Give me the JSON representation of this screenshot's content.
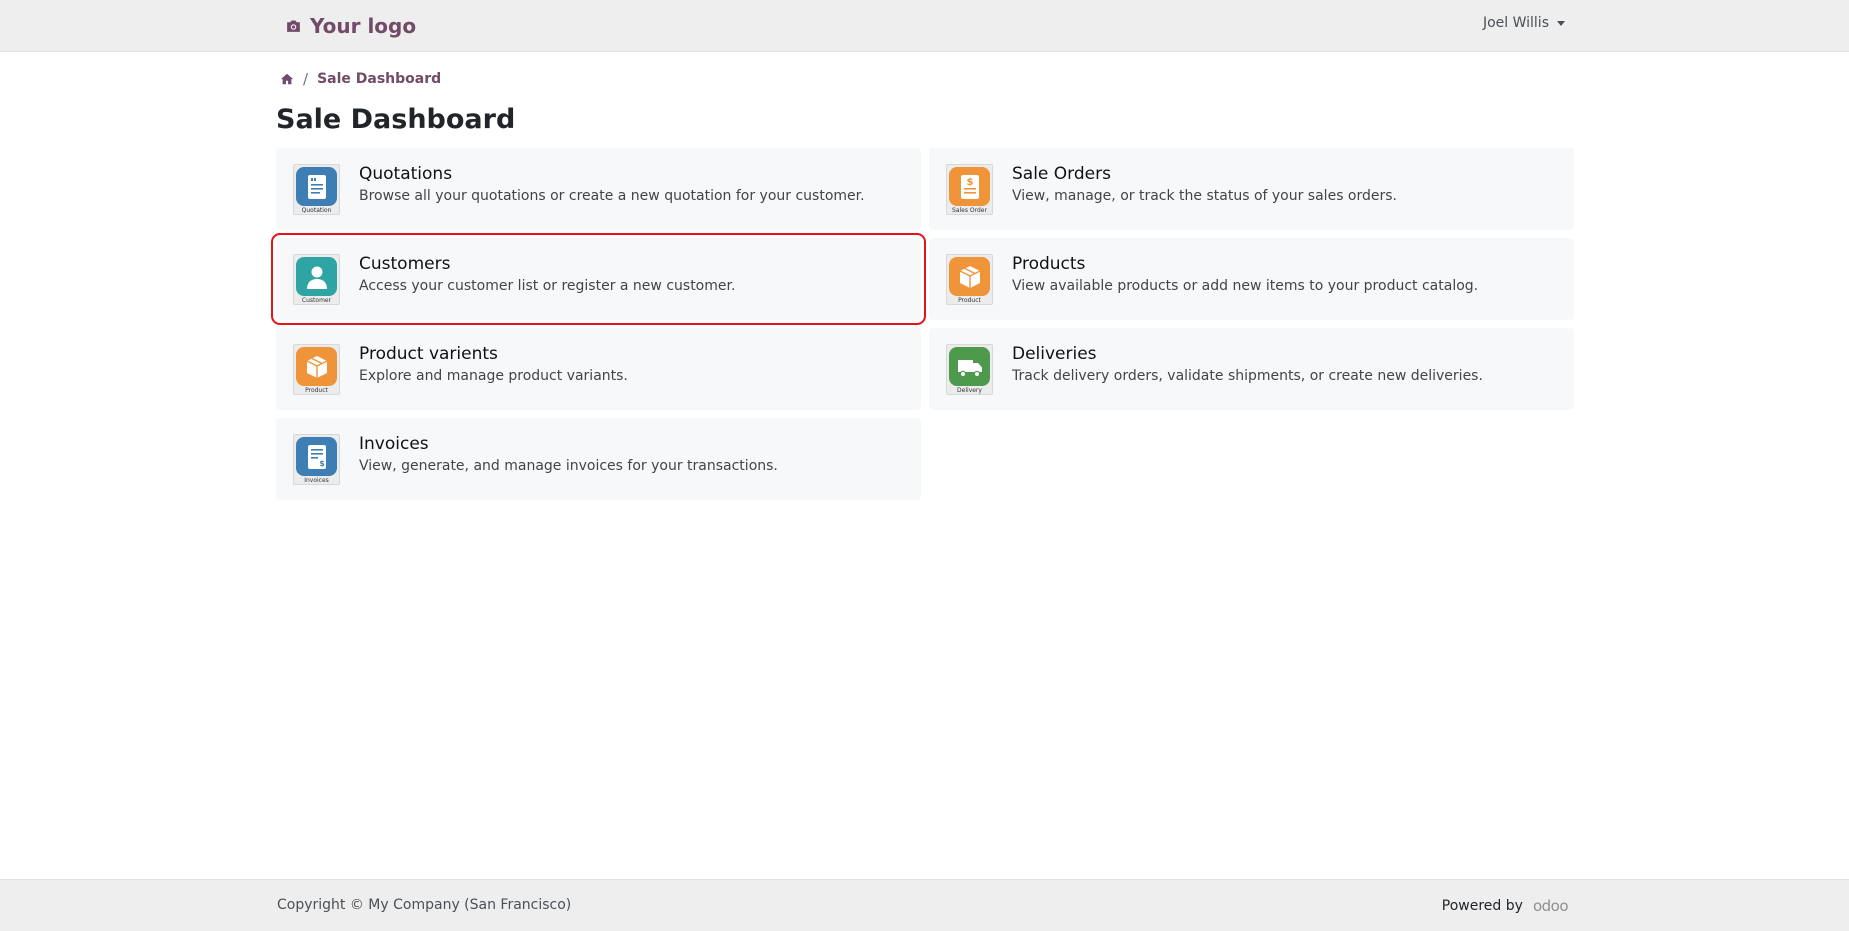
{
  "header": {
    "logo_text": "Your logo",
    "logo_icon": "camera-icon",
    "user_name": "Joel Willis"
  },
  "breadcrumb": {
    "home_icon": "home-icon",
    "separator": "/",
    "current": "Sale Dashboard"
  },
  "page": {
    "title": "Sale Dashboard"
  },
  "cards": [
    {
      "title": "Quotations",
      "description": "Browse all your quotations or create a new quotation for your customer.",
      "icon": "quotation-icon",
      "caption": "Quotation",
      "color": "#3d7fb5"
    },
    {
      "title": "Sale Orders",
      "description": "View, manage, or track the status of your sales orders.",
      "icon": "sales-order-icon",
      "caption": "Sales Order",
      "color": "#f0943a"
    },
    {
      "title": "Customers",
      "description": "Access your customer list or register a new customer.",
      "icon": "customer-icon",
      "caption": "Customer",
      "color": "#2fa4a4"
    },
    {
      "title": "Products",
      "description": "View available products or add new items to your product catalog.",
      "icon": "product-icon",
      "caption": "Product",
      "color": "#f0943a"
    },
    {
      "title": "Product varients",
      "description": "Explore and manage product variants.",
      "icon": "product-icon",
      "caption": "Product",
      "color": "#f0943a"
    },
    {
      "title": "Deliveries",
      "description": "Track delivery orders, validate shipments, or create new deliveries.",
      "icon": "delivery-truck-icon",
      "caption": "Delivery",
      "color": "#4d9a4d"
    },
    {
      "title": "Invoices",
      "description": "View, generate, and manage invoices for your transactions.",
      "icon": "invoice-icon",
      "caption": "Invoices",
      "color": "#3d7fb5"
    }
  ],
  "footer": {
    "copyright": "Copyright © My Company (San Francisco)",
    "powered_by": "Powered by",
    "odoo_logo_text": "odoo"
  },
  "colors": {
    "brand": "#714b67",
    "highlight": "#e5141b",
    "card_bg": "#f7f8fa"
  }
}
